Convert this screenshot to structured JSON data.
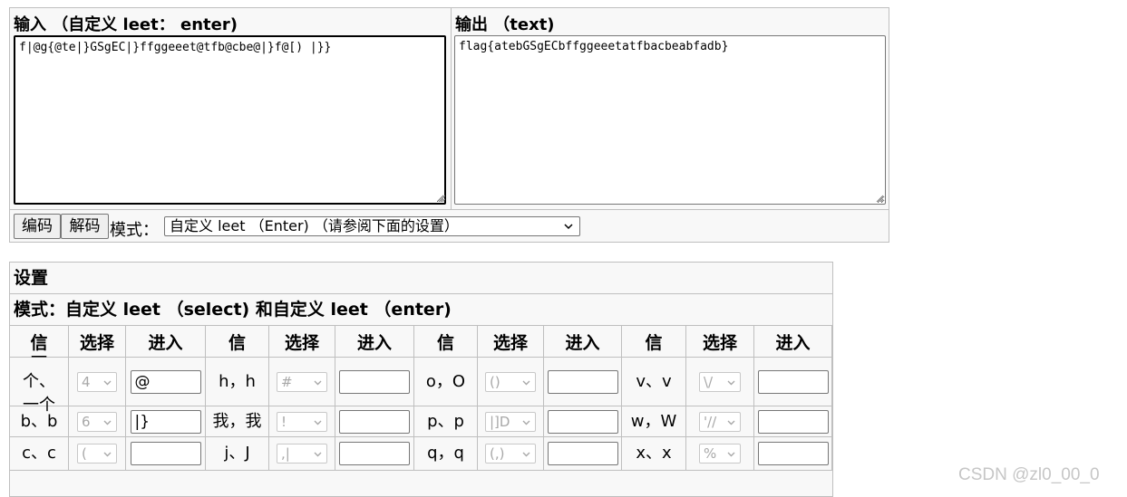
{
  "io": {
    "input_title": "输入 （自定义 leet： enter)",
    "output_title": "输出 （text)",
    "input_value": "f|@g{@te|}GSgEC|}ffggeeet@tfb@cbe@|}f@[) |}}",
    "output_value": "flag{atebGSgECbffggeeetatfbacbeabfadb}",
    "encode_label": "编码",
    "decode_label": "解码",
    "mode_label": "模式：",
    "mode_value": "自定义 leet （Enter) （请参阅下面的设置）"
  },
  "settings": {
    "title": "设置",
    "subtitle": "模式：自定义 leet （select) 和自定义 leet （enter)",
    "headers": [
      "信",
      "选择",
      "进入",
      "信",
      "选择",
      "进入",
      "信",
      "选择",
      "进入",
      "信",
      "选择",
      "进入"
    ],
    "rows": [
      {
        "cells": [
          {
            "chars": "一\n个、\n一个",
            "select": "4",
            "input": "@"
          },
          {
            "chars": "h，h",
            "select": "#",
            "input": ""
          },
          {
            "chars": "o，O",
            "select": "()",
            "input": ""
          },
          {
            "chars": "v、v",
            "select": "\\/",
            "input": ""
          }
        ]
      },
      {
        "cells": [
          {
            "chars": "b、b",
            "select": "6",
            "input": "|}"
          },
          {
            "chars": "我，我",
            "select": "!",
            "input": ""
          },
          {
            "chars": "p、p",
            "select": "|]D",
            "input": ""
          },
          {
            "chars": "w，W",
            "select": "'//",
            "input": ""
          }
        ]
      },
      {
        "cells": [
          {
            "chars": "c、c",
            "select": "(",
            "input": ""
          },
          {
            "chars": "j、J",
            "select": ",|",
            "input": ""
          },
          {
            "chars": "q，q",
            "select": "(,)",
            "input": ""
          },
          {
            "chars": "x、x",
            "select": "%",
            "input": ""
          }
        ]
      }
    ]
  },
  "watermark": "CSDN @zl0_00_0"
}
